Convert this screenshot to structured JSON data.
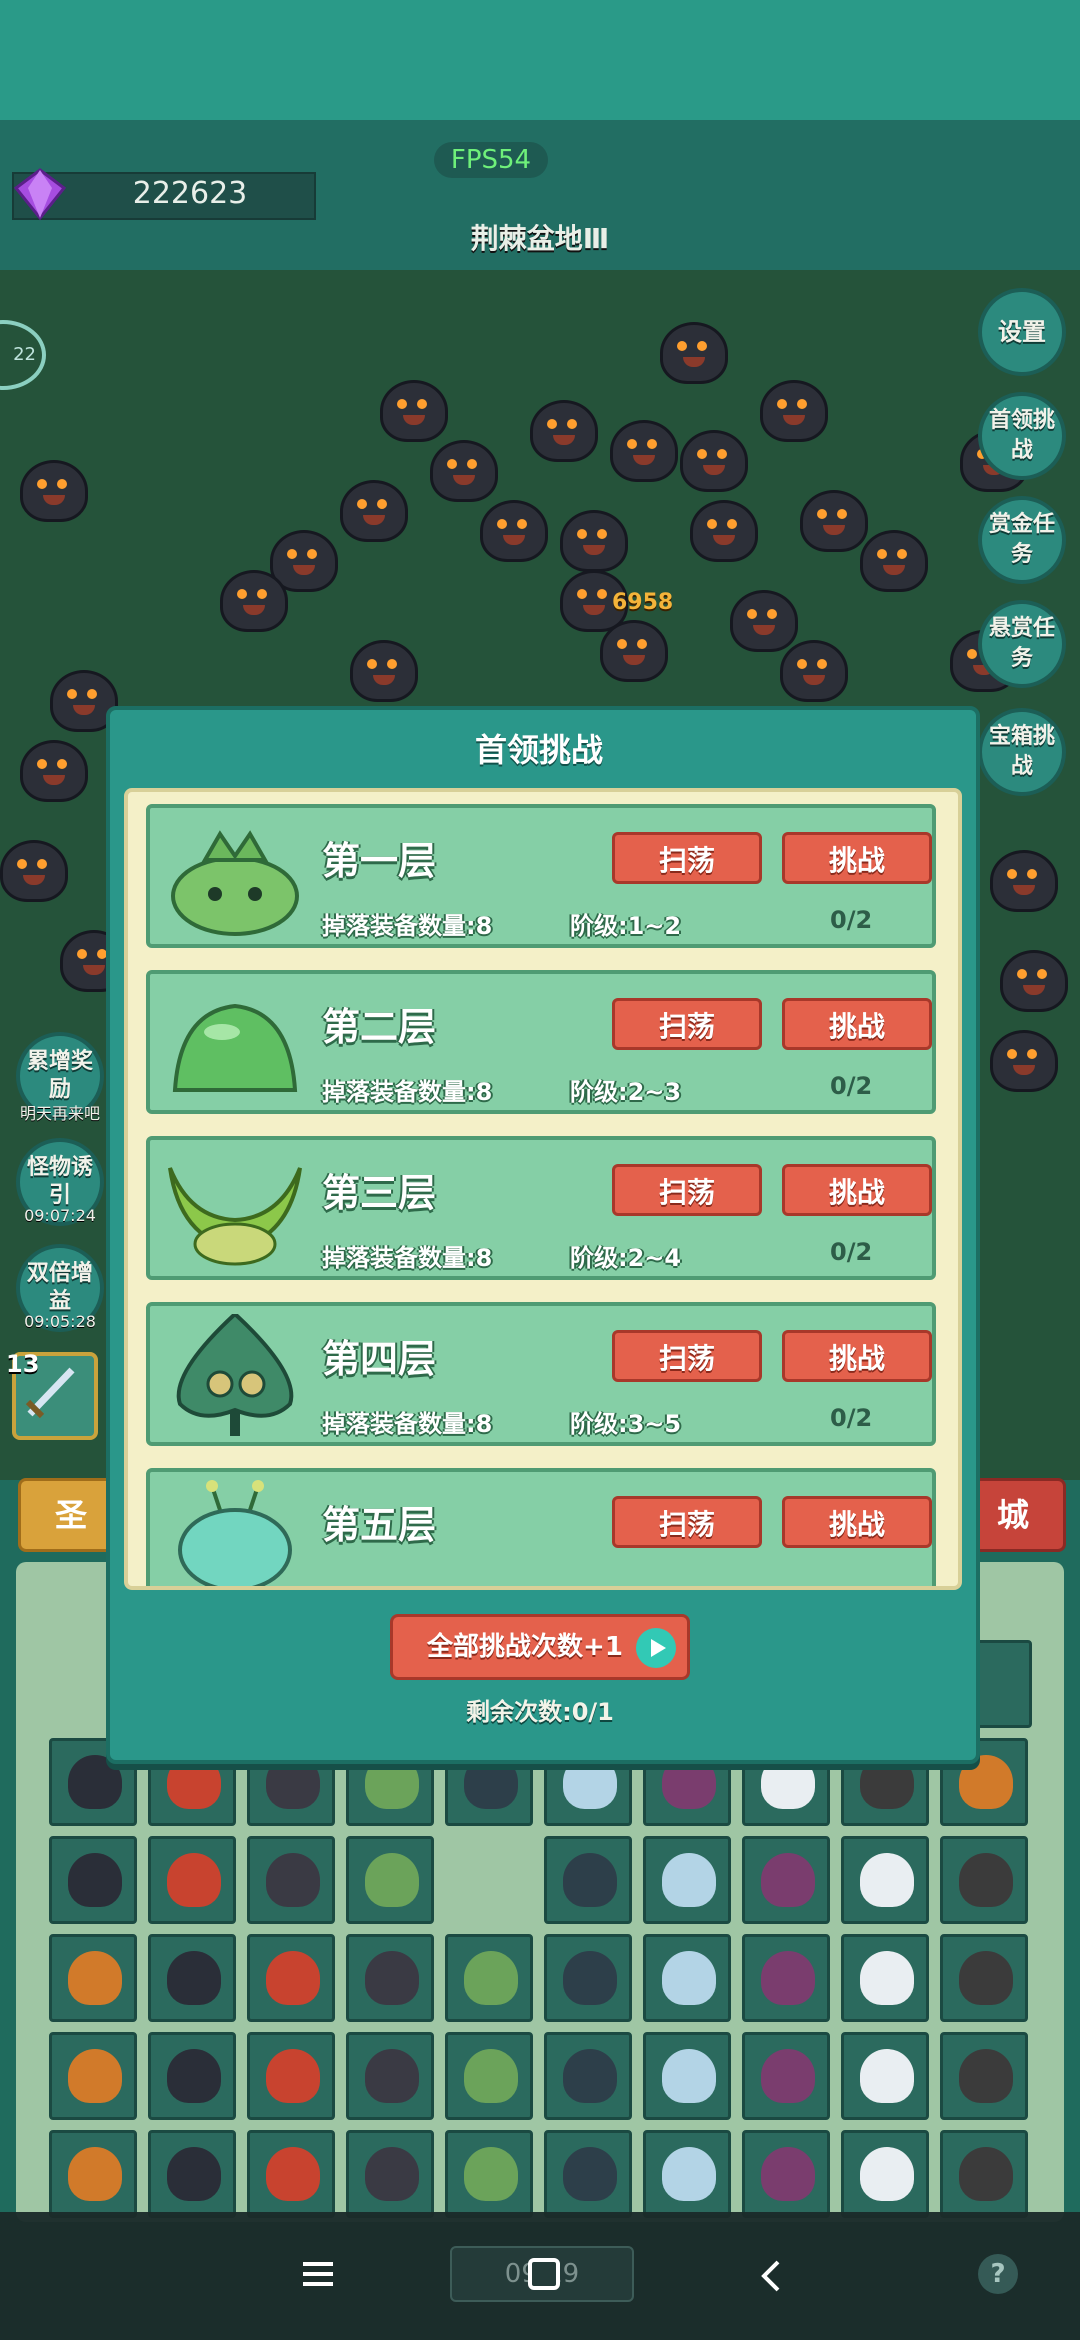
{
  "hud": {
    "gem_count": "222623",
    "fps": "FPS54",
    "stage_name": "荆棘盆地Ⅲ",
    "damage_popup": "6958",
    "left_edge_badge": "22"
  },
  "side_buttons": {
    "settings": "设置",
    "boss_challenge": "首领挑战",
    "bounty_task": "赏金任务",
    "reward_task": "悬赏任务",
    "treasure_challenge": "宝箱挑战"
  },
  "left_buttons": [
    {
      "label": "累增奖励",
      "sub": "明天再来吧"
    },
    {
      "label": "怪物诱引",
      "sub": "09:07:24"
    },
    {
      "label": "双倍增益",
      "sub": "09:05:28"
    }
  ],
  "skill_slot": {
    "level": "13"
  },
  "tabs": {
    "left": "圣",
    "right": "城"
  },
  "modal": {
    "title": "首领挑战",
    "sweep_label": "扫荡",
    "challenge_label": "挑战",
    "floors": [
      {
        "name": "第一层",
        "drop": "掉落装备数量:8",
        "tier": "阶级:1~2",
        "count": "0/2",
        "boss": "green-frog-boss"
      },
      {
        "name": "第二层",
        "drop": "掉落装备数量:8",
        "tier": "阶级:2~3",
        "count": "0/2",
        "boss": "green-slime-boss"
      },
      {
        "name": "第三层",
        "drop": "掉落装备数量:8",
        "tier": "阶级:2~4",
        "count": "0/2",
        "boss": "horned-plant-boss"
      },
      {
        "name": "第四层",
        "drop": "掉落装备数量:8",
        "tier": "阶级:3~5",
        "count": "0/2",
        "boss": "spade-eye-boss"
      },
      {
        "name": "第五层",
        "drop": "",
        "tier": "",
        "count": "",
        "boss": "antenna-blob-boss"
      }
    ],
    "all_plus_label": "全部挑战次数+1",
    "remaining": "剩余次数:0/1"
  },
  "navbar": {
    "clock": "09 19",
    "help": "?"
  },
  "colors": {
    "modal_bg": "#2a978a",
    "floor_bg": "#85cfa6",
    "button_red": "#e4614c",
    "fps_green": "#6ff07a"
  }
}
